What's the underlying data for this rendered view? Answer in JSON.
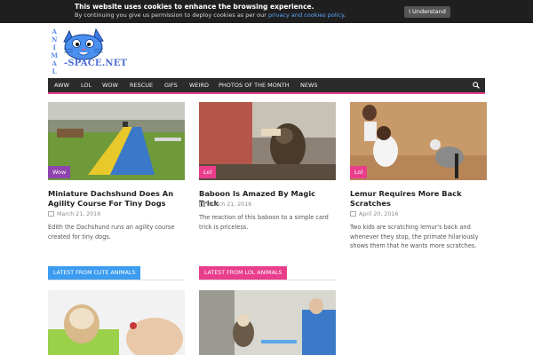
{
  "cookie_bar": {
    "title": "This website uses cookies to enhance the browsing experience.",
    "text": "By continuing you give us permission to deploy cookies as per our ",
    "link": "privacy and cookies policy",
    "text_end": ".",
    "button": "I Understand"
  },
  "logo": {
    "vertical_text": "ANIMAL",
    "bottom_text": "-SPACE.NET"
  },
  "nav": {
    "items": [
      "AWW",
      "LOL",
      "WOW",
      "RESCUE",
      "GIFS",
      "WEIRD",
      "PHOTOS OF THE MONTH",
      "NEWS"
    ],
    "search_icon": "search-icon",
    "accent_color": "#e83e8c"
  },
  "cards": [
    {
      "badge": "Wow",
      "badge_color": "#8e44ad",
      "title": "Miniature Dachshund Does An Agility Course For Tiny Dogs",
      "date": "March 21, 2016",
      "excerpt": "Edith the Dachshund runs an agility course created for tiny dogs."
    },
    {
      "badge": "Lol",
      "badge_color": "#e83e8c",
      "title": "Baboon Is Amazed By Magic Trick",
      "date": "March 21, 2016",
      "excerpt": "The reaction of this baboon to a simple card trick is priceless."
    },
    {
      "badge": "Lol",
      "badge_color": "#e83e8c",
      "title": "Lemur Requires More Back Scratches",
      "date": "April 20, 2016",
      "excerpt": "Two kids are scratching lemur's back and whenever they stop, the primate hilariously shows them that he wants more scratches."
    }
  ],
  "sections": [
    {
      "label": "LATEST FROM CUTE ANIMALS",
      "color": "#3b9cf0"
    },
    {
      "label": "LATEST FROM LOL ANIMALS",
      "color": "#e83e8c"
    }
  ]
}
